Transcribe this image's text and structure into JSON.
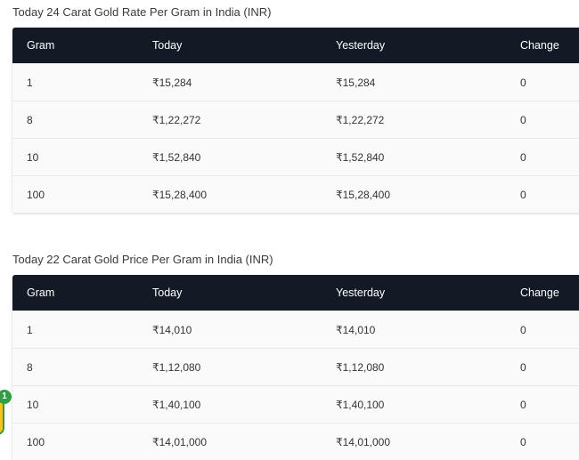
{
  "tables": [
    {
      "title": "Today 24 Carat Gold Rate Per Gram in India (INR)",
      "headers": [
        "Gram",
        "Today",
        "Yesterday",
        "Change"
      ],
      "rows": [
        [
          "1",
          "₹15,284",
          "₹15,284",
          "0"
        ],
        [
          "8",
          "₹1,22,272",
          "₹1,22,272",
          "0"
        ],
        [
          "10",
          "₹1,52,840",
          "₹1,52,840",
          "0"
        ],
        [
          "100",
          "₹15,28,400",
          "₹15,28,400",
          "0"
        ]
      ]
    },
    {
      "title": "Today 22 Carat Gold Price Per Gram in India (INR)",
      "headers": [
        "Gram",
        "Today",
        "Yesterday",
        "Change"
      ],
      "rows": [
        [
          "1",
          "₹14,010",
          "₹14,010",
          "0"
        ],
        [
          "8",
          "₹1,12,080",
          "₹1,12,080",
          "0"
        ],
        [
          "10",
          "₹1,40,100",
          "₹1,40,100",
          "0"
        ],
        [
          "100",
          "₹14,01,000",
          "₹14,01,000",
          "0"
        ]
      ]
    }
  ],
  "widget": {
    "badge_count": "1",
    "colors": {
      "body": "#f5c518",
      "badge": "#2f9e44"
    }
  },
  "colors": {
    "header_bg": "#131a26",
    "header_text": "#ffffff",
    "row_bg": "#fafafa"
  }
}
